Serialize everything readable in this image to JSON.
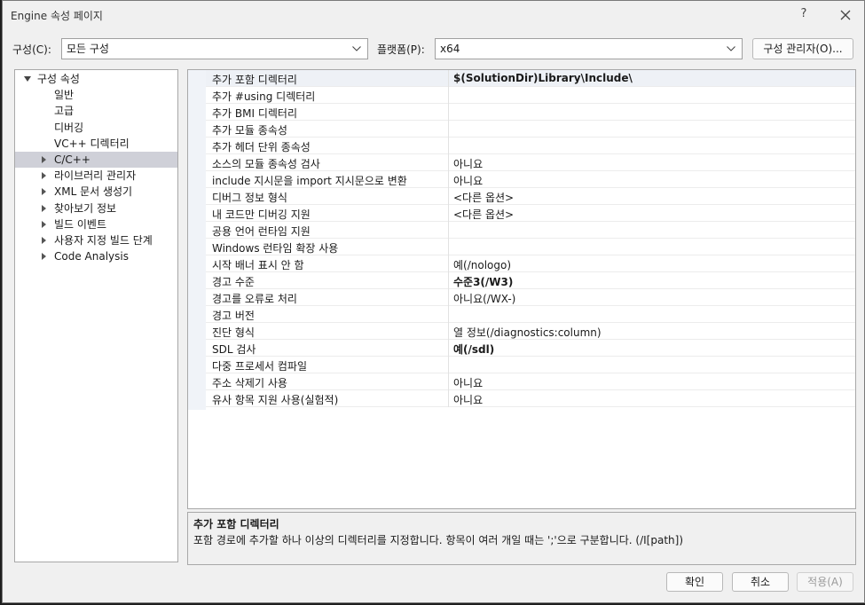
{
  "window": {
    "title": "Engine 속성 페이지",
    "help_label": "?",
    "close_icon": "close-icon"
  },
  "toolbar": {
    "config_label": "구성(C):",
    "config_value": "모든 구성",
    "platform_label": "플랫폼(P):",
    "platform_value": "x64",
    "config_manager_label": "구성 관리자(O)..."
  },
  "tree": {
    "items": [
      {
        "label": "구성 속성",
        "level": 0,
        "toggle": "expanded"
      },
      {
        "label": "일반",
        "level": 1,
        "toggle": "none"
      },
      {
        "label": "고급",
        "level": 1,
        "toggle": "none"
      },
      {
        "label": "디버깅",
        "level": 1,
        "toggle": "none"
      },
      {
        "label": "VC++ 디렉터리",
        "level": 1,
        "toggle": "none"
      },
      {
        "label": "C/C++",
        "level": 1,
        "toggle": "collapsed",
        "selected": true
      },
      {
        "label": "라이브러리 관리자",
        "level": 1,
        "toggle": "collapsed"
      },
      {
        "label": "XML 문서 생성기",
        "level": 1,
        "toggle": "collapsed"
      },
      {
        "label": "찾아보기 정보",
        "level": 1,
        "toggle": "collapsed"
      },
      {
        "label": "빌드 이벤트",
        "level": 1,
        "toggle": "collapsed"
      },
      {
        "label": "사용자 지정 빌드 단계",
        "level": 1,
        "toggle": "collapsed"
      },
      {
        "label": "Code Analysis",
        "level": 1,
        "toggle": "collapsed"
      }
    ]
  },
  "properties": [
    {
      "name": "추가 포함 디렉터리",
      "value": "$(SolutionDir)Library\\Include\\",
      "bold": true,
      "selected": true
    },
    {
      "name": "추가 #using 디렉터리",
      "value": ""
    },
    {
      "name": "추가 BMI 디렉터리",
      "value": ""
    },
    {
      "name": "추가 모듈 종속성",
      "value": ""
    },
    {
      "name": "추가 헤더 단위 종속성",
      "value": ""
    },
    {
      "name": "소스의 모듈 종속성 검사",
      "value": "아니요"
    },
    {
      "name": "include 지시문을 import 지시문으로 변환",
      "value": "아니요"
    },
    {
      "name": "디버그 정보 형식",
      "value": "<다른 옵션>"
    },
    {
      "name": "내 코드만 디버깅 지원",
      "value": "<다른 옵션>"
    },
    {
      "name": "공용 언어 런타임 지원",
      "value": ""
    },
    {
      "name": "Windows 런타임 확장 사용",
      "value": ""
    },
    {
      "name": "시작 배너 표시 안 함",
      "value": "예(/nologo)"
    },
    {
      "name": "경고 수준",
      "value": "수준3(/W3)",
      "bold": true
    },
    {
      "name": "경고를 오류로 처리",
      "value": "아니요(/WX-)"
    },
    {
      "name": "경고 버전",
      "value": ""
    },
    {
      "name": "진단 형식",
      "value": "열 정보(/diagnostics:column)"
    },
    {
      "name": "SDL 검사",
      "value": "예(/sdl)",
      "bold": true
    },
    {
      "name": "다중 프로세서 컴파일",
      "value": ""
    },
    {
      "name": "주소 삭제기 사용",
      "value": "아니요"
    },
    {
      "name": "유사 항목 지원 사용(실험적)",
      "value": "아니요"
    }
  ],
  "description": {
    "title": "추가 포함 디렉터리",
    "text": "포함 경로에 추가할 하나 이상의 디렉터리를 지정합니다. 항목이 여러 개일 때는 ';'으로 구분합니다. (/I[path])"
  },
  "buttons": {
    "ok": "확인",
    "cancel": "취소",
    "apply": "적용(A)"
  },
  "colors": {
    "selection": "#cfd0d8",
    "window_bg": "#f0f0f0"
  }
}
